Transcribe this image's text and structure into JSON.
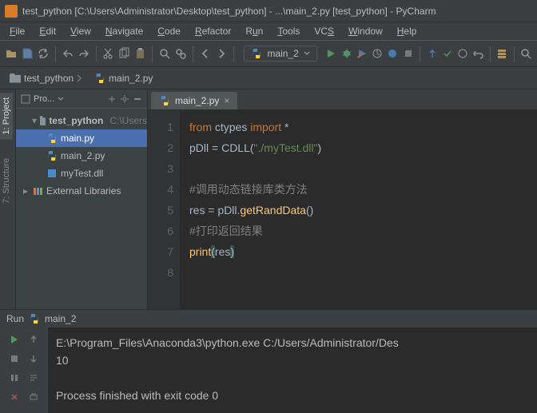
{
  "title": "test_python [C:\\Users\\Administrator\\Desktop\\test_python] - ...\\main_2.py [test_python] - PyCharm",
  "menu": [
    "File",
    "Edit",
    "View",
    "Navigate",
    "Code",
    "Refactor",
    "Run",
    "Tools",
    "VCS",
    "Window",
    "Help"
  ],
  "run_config": "main_2",
  "breadcrumb": {
    "root": "test_python",
    "file": "main_2.py"
  },
  "side_tabs": {
    "project": "1: Project",
    "structure": "7: Structure"
  },
  "project_tool": {
    "title": "Pro...",
    "root": "test_python",
    "root_path": "C:\\Users",
    "files": [
      "main.py",
      "main_2.py",
      "myTest.dll"
    ],
    "external": "External Libraries"
  },
  "editor_tab": "main_2.py",
  "code": {
    "l1": {
      "a": "from ",
      "b": "ctypes ",
      "c": "import ",
      "d": "*"
    },
    "l2": {
      "a": "pDll = ",
      "b": "CDLL",
      "c": "(",
      "d": "\"./myTest.dll\"",
      "e": ")"
    },
    "l4": "#调用动态链接库类方法",
    "l5": {
      "a": "res = pDll.",
      "b": "getRandData",
      "c": "()"
    },
    "l6": "#打印返回结果",
    "l7": {
      "a": "print",
      "b": "(",
      "c": "res",
      "d": ")"
    }
  },
  "gutter_lines": [
    "1",
    "2",
    "3",
    "4",
    "5",
    "6",
    "7",
    "8"
  ],
  "run_panel": {
    "label": "Run",
    "name": "main_2",
    "cmd": "E:\\Program_Files\\Anaconda3\\python.exe C:/Users/Administrator/Des",
    "out": "10",
    "exit": "Process finished with exit code 0"
  }
}
